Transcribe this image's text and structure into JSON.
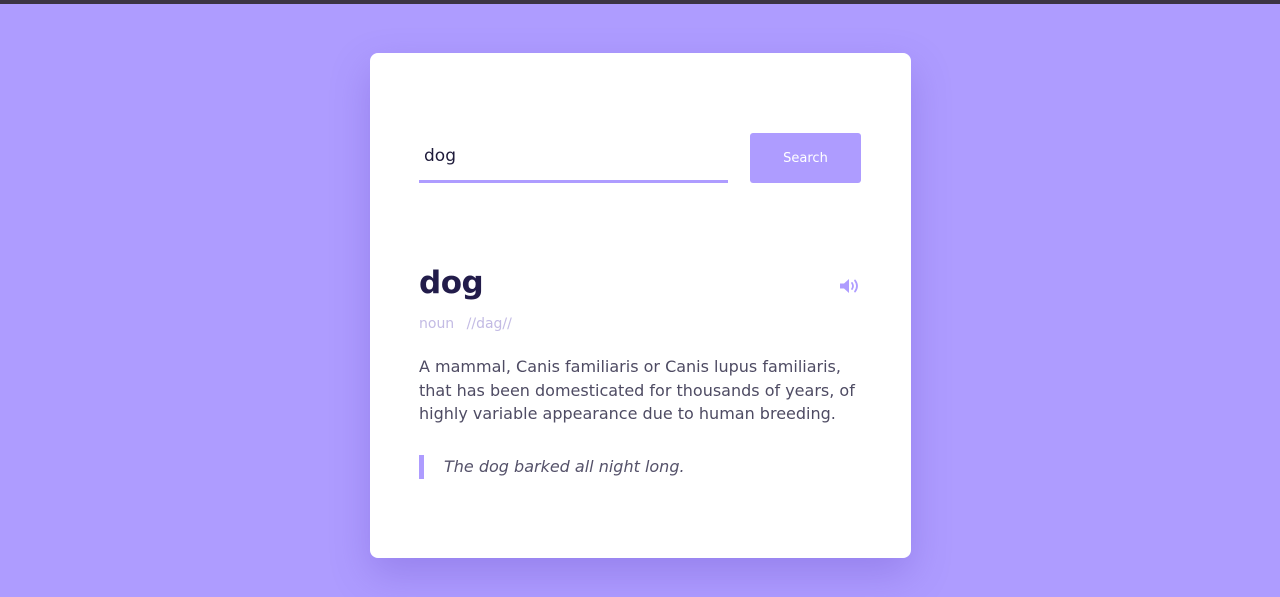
{
  "search": {
    "value": "dog",
    "button_label": "Search"
  },
  "entry": {
    "word": "dog",
    "part_of_speech": "noun",
    "pronunciation": "//dag//",
    "audio_icon": "speaker-icon",
    "definition": "A mammal, Canis familiaris or Canis lupus familiaris, that has been domesticated for thousands of years, of highly variable appearance due to human breeding.",
    "example": "The dog barked all night long."
  },
  "colors": {
    "background": "#ae9cff",
    "accent": "#ae9cff",
    "card": "#ffffff",
    "heading": "#221c4a",
    "body_text": "#4e4b63",
    "muted_text": "#c3bbe4"
  }
}
